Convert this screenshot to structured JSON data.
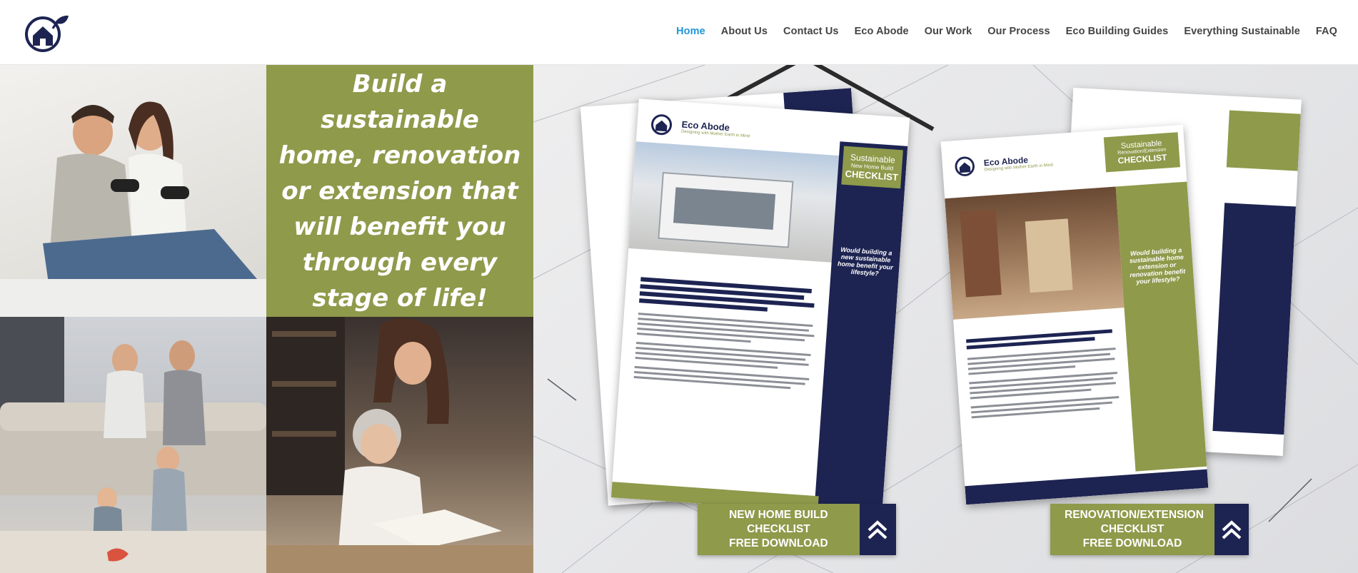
{
  "brand": {
    "name": "Eco Abode"
  },
  "nav": {
    "items": [
      {
        "label": "Home",
        "active": true
      },
      {
        "label": "About Us"
      },
      {
        "label": "Contact Us"
      },
      {
        "label": "Eco Abode"
      },
      {
        "label": "Our Work"
      },
      {
        "label": "Our Process"
      },
      {
        "label": "Eco Building Guides"
      },
      {
        "label": "Everything Sustainable"
      },
      {
        "label": "FAQ"
      }
    ]
  },
  "hero": {
    "quote": "Build a sustainable home, renovation or extension that will benefit you through every stage of life!",
    "flyer_new": {
      "brand": "Eco Abode",
      "tagline": "Designing with Mother Earth in Mind",
      "title_small": "Sustainable",
      "title_mid": "New Home Build",
      "title_big": "CHECKLIST",
      "question": "Would building a new sustainable home benefit your lifestyle?"
    },
    "flyer_reno": {
      "brand": "Eco Abode",
      "tagline": "Designing with Mother Earth in Mind",
      "title_small": "Sustainable",
      "title_mid": "Renovation/Extension",
      "title_big": "CHECKLIST",
      "question": "Would building a sustainable home extension or renovation benefit your lifestyle?"
    },
    "cta_new": {
      "line1": "NEW HOME BUILD",
      "line2": "CHECKLIST",
      "line3": "FREE DOWNLOAD"
    },
    "cta_reno": {
      "line1": "RENOVATION/EXTENSION",
      "line2": "CHECKLIST",
      "line3": "FREE DOWNLOAD"
    }
  },
  "colors": {
    "olive": "#8f9a4b",
    "navy": "#1d2452",
    "nav_active": "#1e96d8",
    "nav_text": "#444444"
  }
}
